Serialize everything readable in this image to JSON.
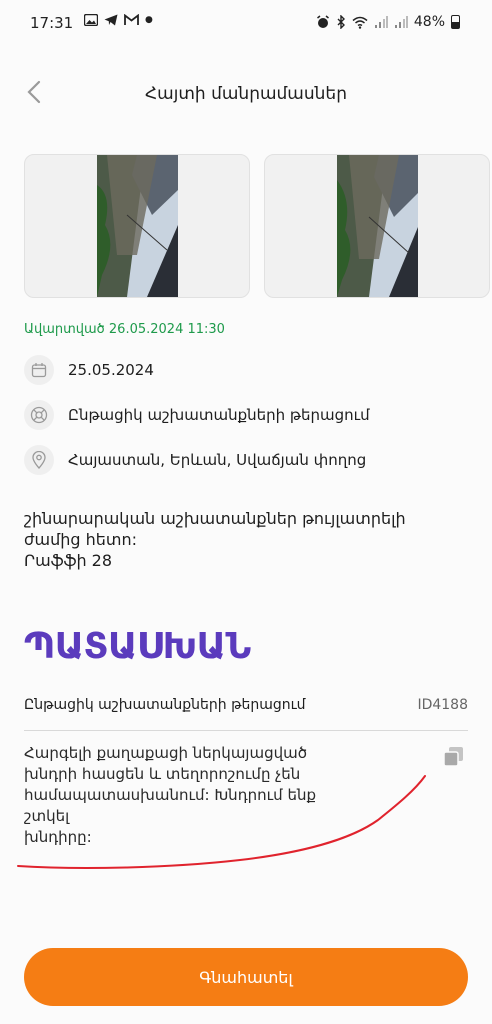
{
  "status_bar": {
    "time": "17:31",
    "battery": "48%"
  },
  "header": {
    "title": "Հայտի մանրամասներ"
  },
  "request": {
    "status_label": "Ավարտված",
    "status_datetime": "26.05.2024 11:30",
    "status_color": "#1e9a4b",
    "date": "25.05.2024",
    "category": "Ընթացիկ աշխատանքների թերացում",
    "location": "Հայաստան, Երևան, Սվաճյան փողոց",
    "description": "շինարարական աշխատանքներ թույլատրելի\nժամից հետո:\nՐաֆֆի 28"
  },
  "answer": {
    "heading": "ՊԱՏԱՍԽԱՆ",
    "heading_color": "#5b3bbd",
    "category": "Ընթացիկ աշխատանքների թերացում",
    "id": "ID4188",
    "text": "Հարգելի քաղաքացի ներկայացված\nխնդրի հասցեն և տեղորոշումը չեն\nհամապատասխանում: Խնդրում ենք շտկել\nխնդիրը:"
  },
  "actions": {
    "rate_label": "Գնահատել",
    "rate_color": "#f57d14"
  },
  "icons": {
    "back": "chevron-left-icon",
    "date": "calendar-icon",
    "category": "category-icon",
    "location": "location-pin-icon",
    "copy": "copy-icon"
  }
}
